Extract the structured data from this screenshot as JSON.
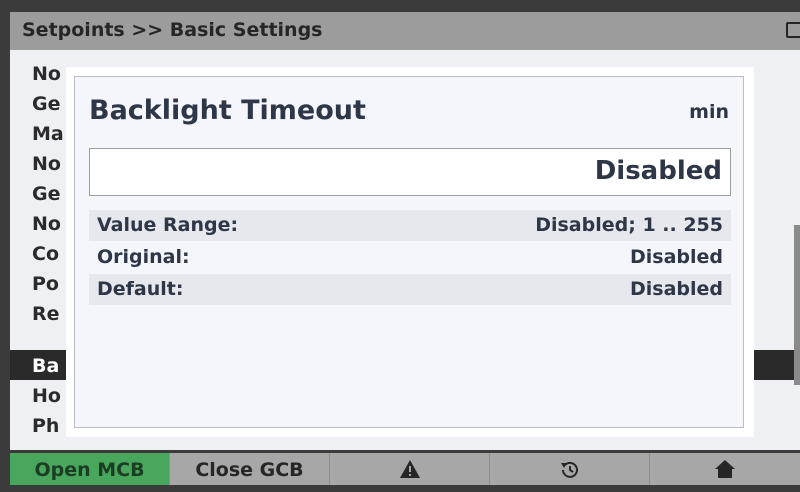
{
  "header": {
    "title": "Setpoints >> Basic Settings",
    "status_icon": "battery-icon"
  },
  "list": {
    "items": [
      {
        "label": "No"
      },
      {
        "label": "Ge"
      },
      {
        "label": "Ma"
      },
      {
        "label": "No"
      },
      {
        "label": "Ge"
      },
      {
        "label": "No"
      },
      {
        "label": "Co"
      },
      {
        "label": "Po"
      },
      {
        "label": "Re"
      },
      {
        "label": "Ba",
        "selected": true
      },
      {
        "label": "Ho"
      },
      {
        "label": "Ph"
      }
    ]
  },
  "dialog": {
    "title": "Backlight Timeout",
    "unit": "min",
    "current_value": "Disabled",
    "rows": [
      {
        "label": "Value Range:",
        "value": "Disabled; 1 .. 255"
      },
      {
        "label": "Original:",
        "value": "Disabled"
      },
      {
        "label": "Default:",
        "value": "Disabled"
      }
    ]
  },
  "softkeys": {
    "open_mcb": "Open MCB",
    "close_gcb": "Close GCB",
    "alarm_icon": "warning-icon",
    "history_icon": "history-icon",
    "home_icon": "home-icon",
    "active_color": "#49a75d"
  }
}
